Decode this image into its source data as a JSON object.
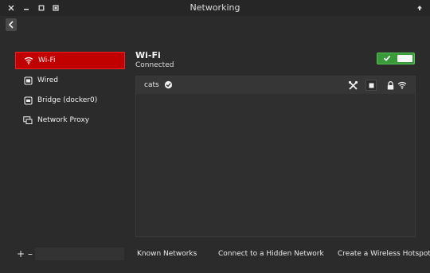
{
  "window": {
    "title": "Networking"
  },
  "sidebar": {
    "items": [
      {
        "label": "Wi-Fi",
        "icon": "wifi-icon",
        "active": true
      },
      {
        "label": "Wired",
        "icon": "wired-icon",
        "active": false
      },
      {
        "label": "Bridge (docker0)",
        "icon": "bridge-icon",
        "active": false
      },
      {
        "label": "Network Proxy",
        "icon": "proxy-icon",
        "active": false
      }
    ],
    "footer": {
      "add": "+",
      "remove": "–"
    }
  },
  "main": {
    "title": "Wi-Fi",
    "status": "Connected",
    "toggle_on": true,
    "networks": [
      {
        "name": "cats",
        "connected": true
      }
    ]
  },
  "actions": {
    "known": "Known Networks",
    "hidden": "Connect to a Hidden Network",
    "hotspot": "Create a Wireless Hotspot"
  },
  "colors": {
    "accent_active": "#c10000",
    "toggle_on": "#3a9a3a",
    "background": "#2b2b2b"
  }
}
